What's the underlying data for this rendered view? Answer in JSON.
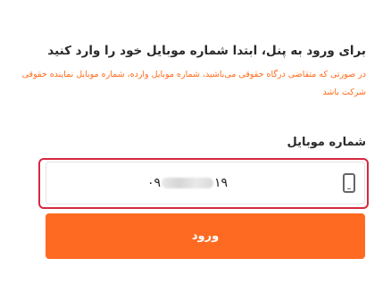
{
  "login": {
    "heading": "برای ورود به پنل، ابتدا شماره موبایل خود را وارد کنید",
    "notice": "در صورتی که متقاضی درگاه حقوقی می‌باشید، شماره موبایل وارده، شماره موبایل نماینده حقوقی شرکت باشد",
    "phone_label": "شماره موبایل",
    "phone_prefix": "۰۹",
    "phone_suffix": "۱۹",
    "submit_label": "ورود"
  },
  "icons": {
    "phone_field": "mobile-phone-icon"
  },
  "colors": {
    "accent": "#ff6a22",
    "notice_text": "#ff6b1a",
    "focus_outline": "#d6283f"
  }
}
